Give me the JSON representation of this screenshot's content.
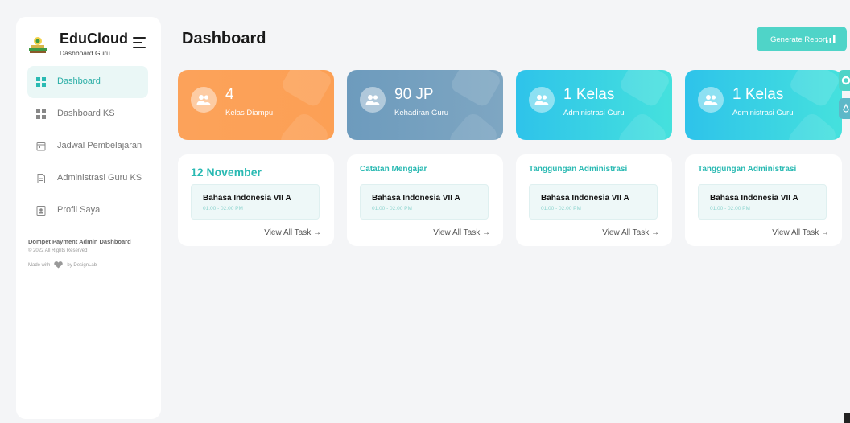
{
  "brand": {
    "name": "EduCloud",
    "subtitle": "Dashboard Guru"
  },
  "sidebar": {
    "items": [
      {
        "label": "Dashboard",
        "icon": "grid-icon",
        "active": true
      },
      {
        "label": "Dashboard KS",
        "icon": "grid-icon",
        "active": false
      },
      {
        "label": "Jadwal Pembelajaran",
        "icon": "calendar-icon",
        "active": false
      },
      {
        "label": "Administrasi Guru KS",
        "icon": "document-icon",
        "active": false
      },
      {
        "label": "Profil Saya",
        "icon": "profile-icon",
        "active": false
      }
    ],
    "footer": {
      "title": "Dompet Payment Admin Dashboard",
      "copyright": "© 2022 All Rights Reserved",
      "made_with": "Made with",
      "by": "by DesignLab"
    }
  },
  "header": {
    "title": "Dashboard",
    "generate_label": "Generate Report"
  },
  "stats": [
    {
      "value": "4",
      "label": "Kelas Diampu"
    },
    {
      "value": "90 JP",
      "label": "Kehadiran Guru"
    },
    {
      "value": "1 Kelas",
      "label": "Administrasi Guru"
    },
    {
      "value": "1 Kelas",
      "label": "Administrasi Guru"
    }
  ],
  "tasks": [
    {
      "heading": "12 November",
      "item_title": "Bahasa Indonesia VII A",
      "item_time": "01.00 - 02.00 PM",
      "view_all": "View All Task →"
    },
    {
      "heading": "Catatan Mengajar",
      "item_title": "Bahasa Indonesia VII A",
      "item_time": "01.00 - 02.00 PM",
      "view_all": "View All Task →"
    },
    {
      "heading": "Tanggungan Administrasi",
      "item_title": "Bahasa Indonesia VII A",
      "item_time": "01.00 - 02.00 PM",
      "view_all": "View All Task →"
    },
    {
      "heading": "Tanggungan Administrasi",
      "item_title": "Bahasa Indonesia VII A",
      "item_time": "01.00 - 02.00 PM",
      "view_all": "View All Task →"
    }
  ],
  "colors": {
    "accent": "#4fd4c8",
    "teal_text": "#2bbab3",
    "orange": "#fca25a",
    "slate": "#6d9bbd",
    "cyan": "#2ec3ea"
  }
}
